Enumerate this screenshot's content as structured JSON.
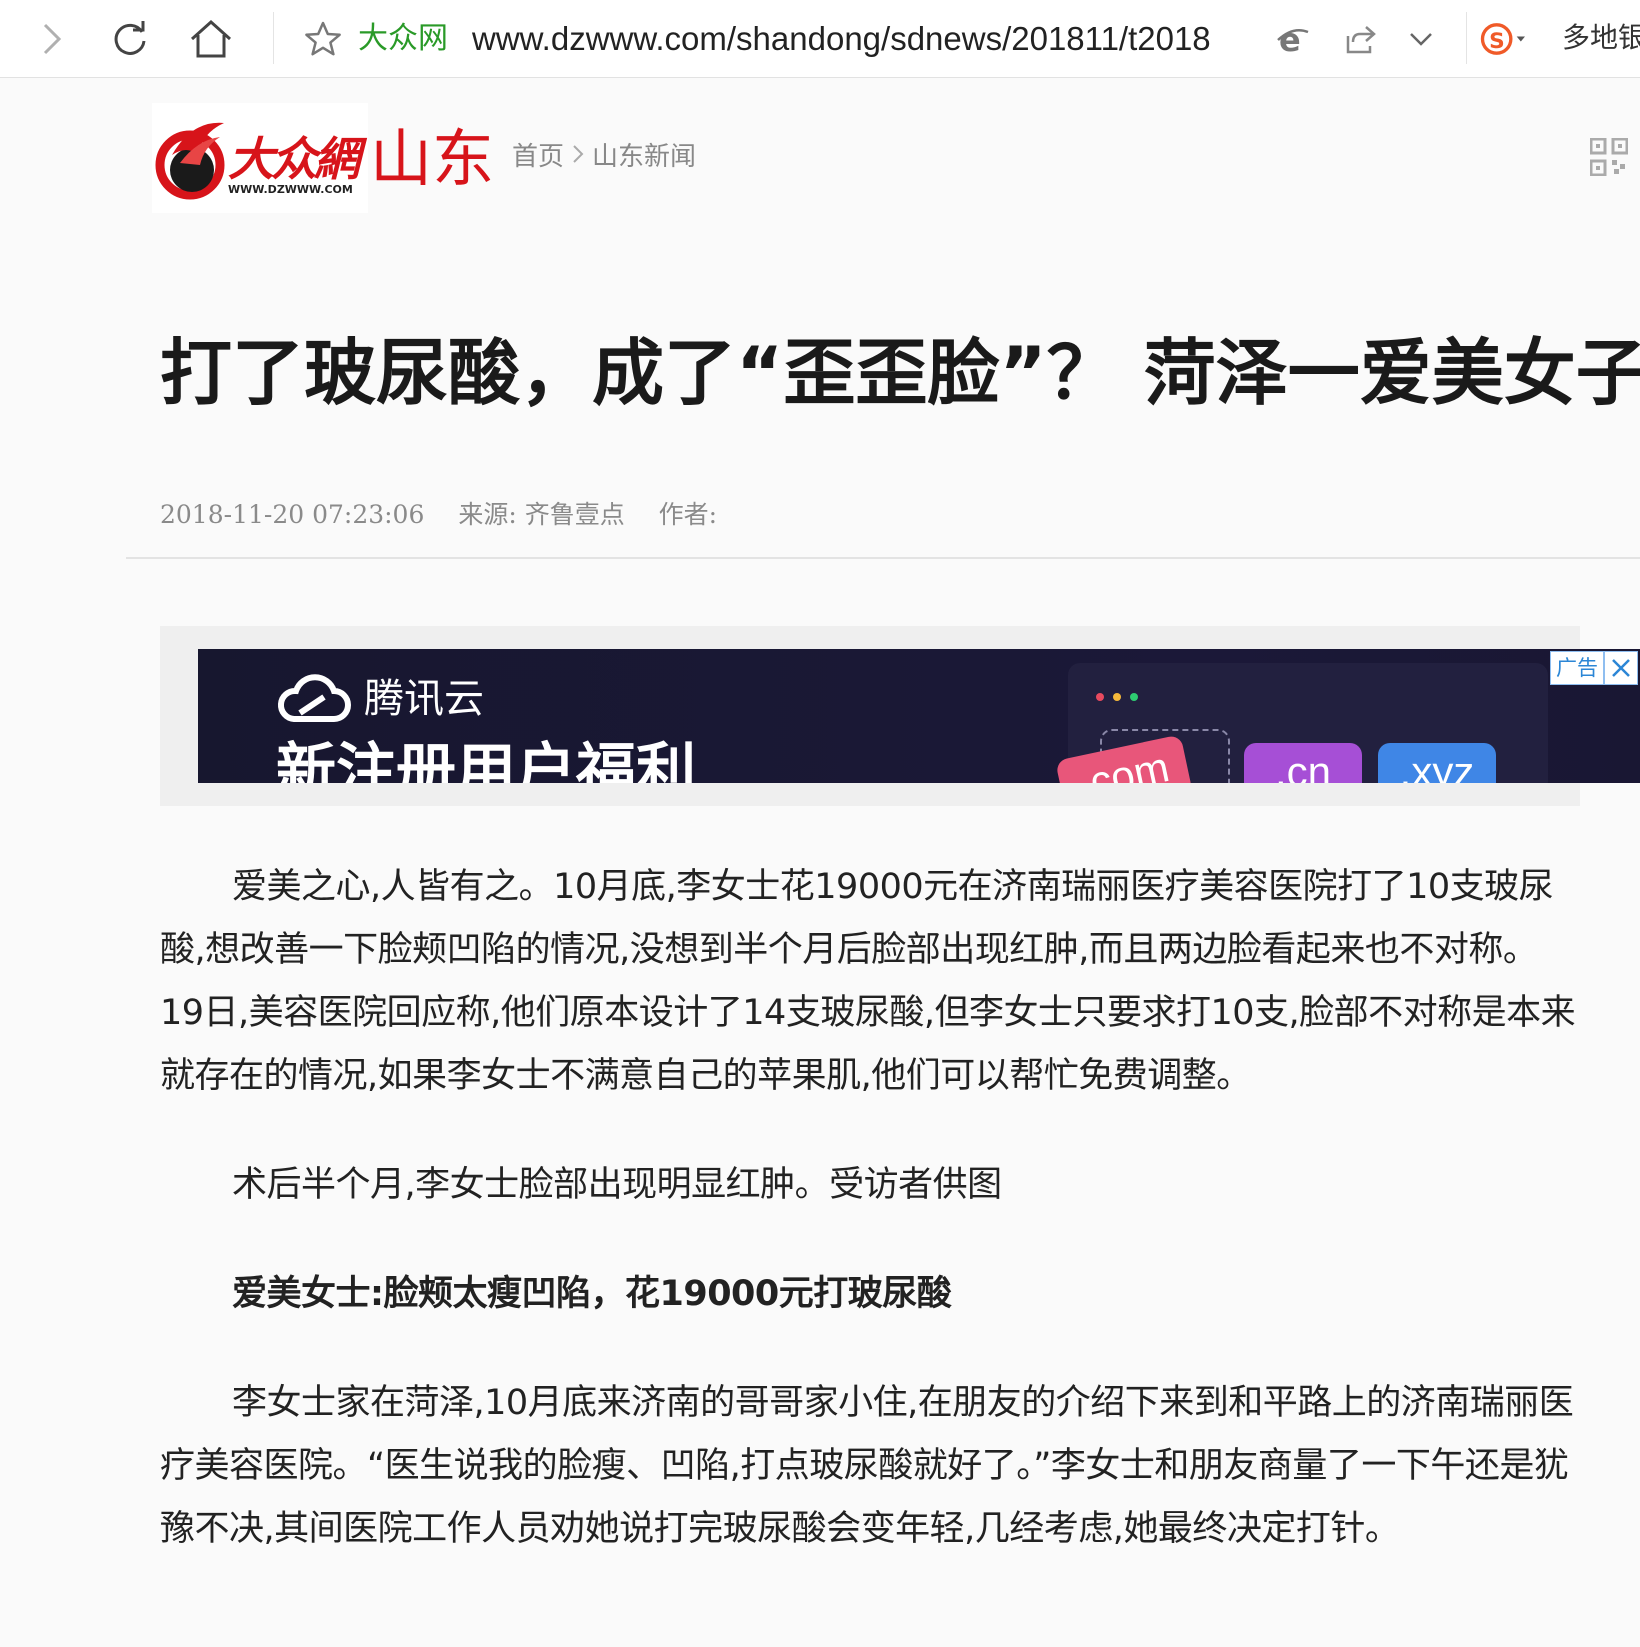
{
  "browser": {
    "site_name": "大众网",
    "url": "www.dzwww.com/shandong/sdnews/201811/t2018",
    "multi_bank_label": "多地银",
    "icons": [
      "forward-icon",
      "refresh-icon",
      "home-icon",
      "favorite-star-icon",
      "ie-compat-icon",
      "share-icon",
      "dropdown-chevron-icon",
      "sogou-icon"
    ]
  },
  "header": {
    "logo_text": "大众網",
    "logo_url_text": "WWW.DZWWW.COM",
    "region": "山东",
    "breadcrumb": [
      "首页",
      "山东新闻"
    ]
  },
  "article": {
    "title": "打了玻尿酸，成了“歪歪脸”？ 菏泽一爱美女子遇",
    "datetime": "2018-11-20 07:23:06",
    "source": "来源: 齐鲁壹点",
    "author": "作者:",
    "paragraphs": [
      "爱美之心,人皆有之。10月底,李女士花19000元在济南瑞丽医疗美容医院打了10支玻尿酸,想改善一下脸颊凹陷的情况,没想到半个月后脸部出现红肿,而且两边脸看起来也不对称。19日,美容医院回应称,他们原本设计了14支玻尿酸,但李女士只要求打10支,脸部不对称是本来就存在的情况,如果李女士不满意自己的苹果肌,他们可以帮忙免费调整。",
      "术后半个月,李女士脸部出现明显红肿。受访者供图",
      "爱美女士:脸颊太瘦凹陷，花19000元打玻尿酸",
      "李女士家在菏泽,10月底来济南的哥哥家小住,在朋友的介绍下来到和平路上的济南瑞丽医疗美容医院。“医生说我的脸瘦、凹陷,打点玻尿酸就好了。”李女士和朋友商量了一下午还是犹豫不决,其间医院工作人员劝她说打完玻尿酸会变年轻,几经考虑,她最终决定打针。"
    ]
  },
  "ad": {
    "brand": "腾讯云",
    "headline": "新注册用户福利",
    "domains": [
      ".com",
      ".cn",
      ".xyz"
    ],
    "tag": "广告",
    "colors": {
      "cn": "#a64fd6",
      "xyz": "#3f86e6",
      "com": "#e8567a"
    }
  }
}
